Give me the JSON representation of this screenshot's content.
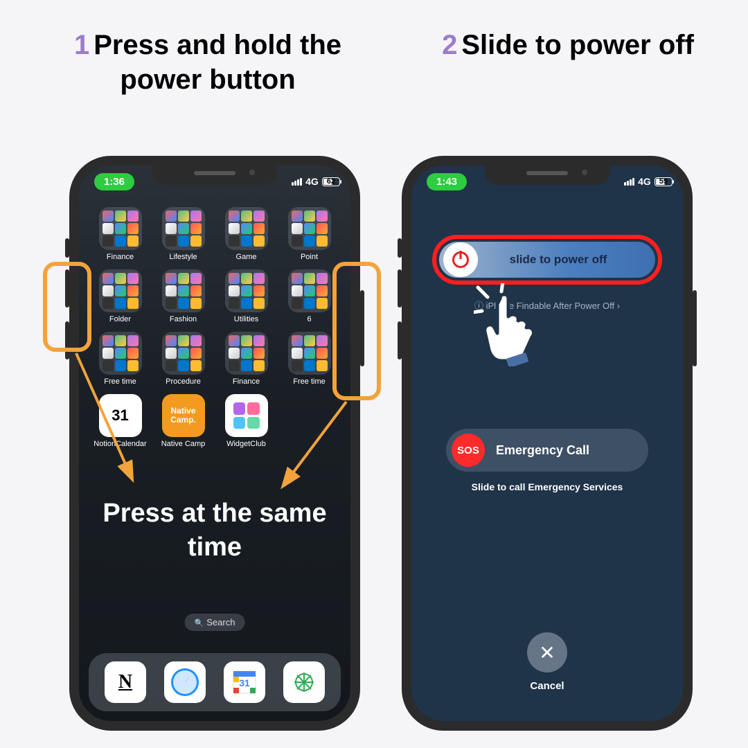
{
  "step1": {
    "num": "1",
    "title": "Press and hold the power button",
    "overlay": "Press at the same time"
  },
  "step2": {
    "num": "2",
    "title": "Slide to power off"
  },
  "phone1": {
    "status": {
      "time": "1:36",
      "carrier": "4G",
      "battery": "62",
      "batt_pct": 62
    },
    "folders": [
      "Finance",
      "Lifestyle",
      "Game",
      "Point",
      "Folder",
      "Fashion",
      "Utilities",
      "6",
      "Free time",
      "Procedure",
      "Finance",
      "Free time"
    ],
    "apps": [
      {
        "id": "notion-calendar",
        "label": "NotionCalendar",
        "face": "31"
      },
      {
        "id": "native-camp",
        "label": "Native Camp",
        "face": "Native Camp."
      },
      {
        "id": "widget-club",
        "label": "WidgetClub",
        "face": ""
      }
    ],
    "search": "Search",
    "dock": [
      "Notion",
      "Safari",
      "Google Calendar",
      "ChatGPT"
    ]
  },
  "phone2": {
    "status": {
      "time": "1:43",
      "carrier": "4G",
      "battery": "59",
      "batt_pct": 59
    },
    "slider_label": "slide to power off",
    "findable": "iPhone Findable After Power Off",
    "sos_label": "Emergency Call",
    "sos_badge": "SOS",
    "sos_sub": "Slide to call Emergency Services",
    "cancel": "Cancel"
  },
  "colors": {
    "highlight_orange": "#f2a33c",
    "highlight_red": "#ff1f1f",
    "step_purple": "#9c7cc9"
  }
}
